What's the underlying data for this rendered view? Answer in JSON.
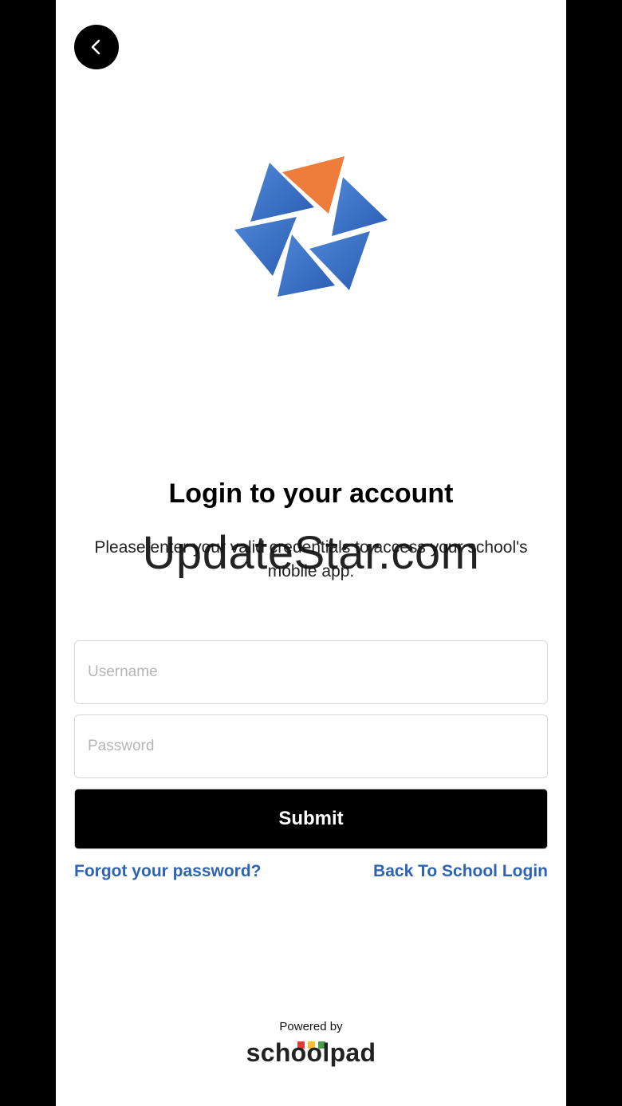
{
  "header": {
    "back_icon": "chevron-left-icon"
  },
  "logo": {
    "icon": "star-pinwheel-logo-icon",
    "colors": {
      "blue": "#3a6fc2",
      "orange": "#ee7d3b"
    }
  },
  "login": {
    "title": "Login to your account",
    "subtitle": "Please enter your valid credentials to access your school's mobile app.",
    "username_placeholder": "Username",
    "password_placeholder": "Password",
    "submit_label": "Submit",
    "forgot_label": "Forgot your password?",
    "back_school_label": "Back To School Login"
  },
  "watermark": {
    "text": "UpdateStar.com"
  },
  "footer": {
    "powered_by": "Powered by",
    "brand": "schoolpad",
    "brand_dot_colors": [
      "#e53935",
      "#fbc02d",
      "#43a047"
    ]
  },
  "colors": {
    "link": "#2e63b3",
    "button": "#000000"
  }
}
